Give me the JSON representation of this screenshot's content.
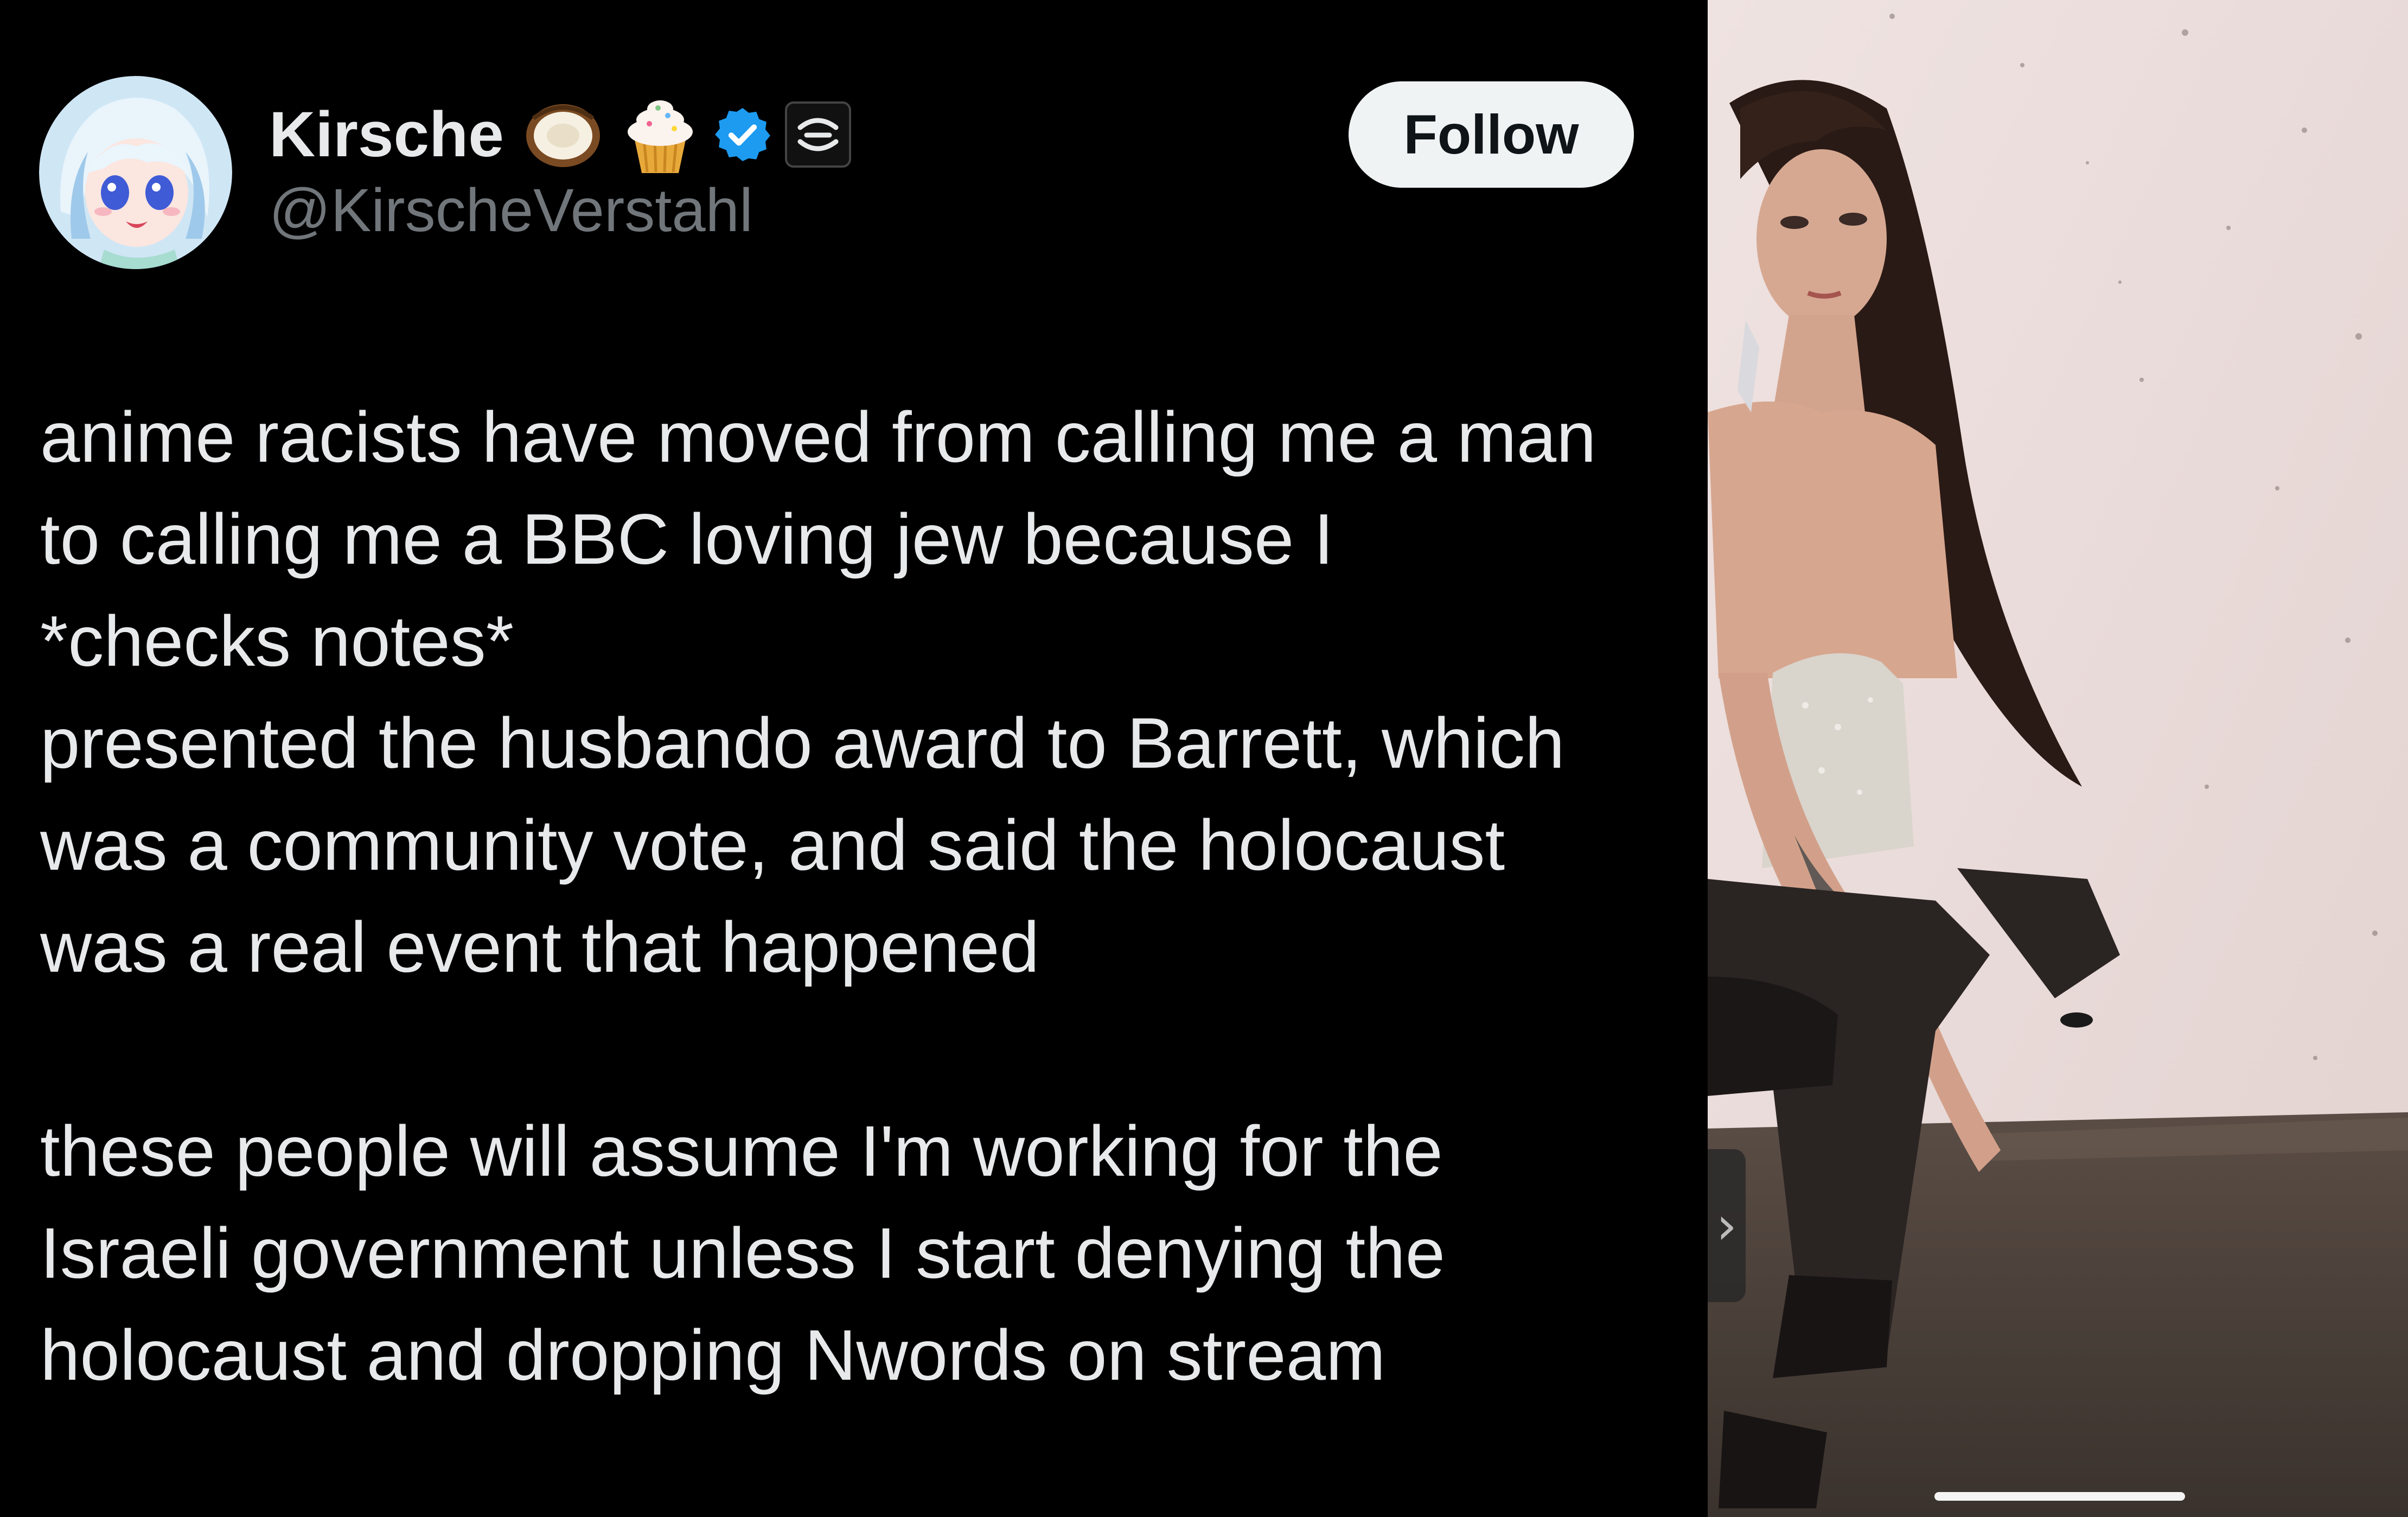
{
  "tweet": {
    "display_name": "Kirsche",
    "handle": "@KirscheVerstahl",
    "follow_label": "Follow",
    "badges": [
      "coconut-emoji",
      "cupcake-emoji",
      "verified-badge-icon",
      "affiliate-badge-icon"
    ],
    "paragraphs": [
      [
        "anime racists have moved from calling me a man",
        "to calling me a BBC loving jew because I",
        "*checks notes*",
        "presented the husbando award to Barrett, which",
        "was a community vote, and said the holocaust",
        "was a real event that happened"
      ],
      [
        "these people will assume I'm working for the",
        "Israeli government unless I start denying the",
        "holocaust and dropping Nwords on stream"
      ]
    ]
  },
  "photo": {
    "side_handle_glyph": "›"
  },
  "colors": {
    "background": "#000000",
    "text": "#e7e9ea",
    "handle": "#71767b",
    "follow_button": "#eff3f4",
    "verified": "#1d9bf0"
  }
}
